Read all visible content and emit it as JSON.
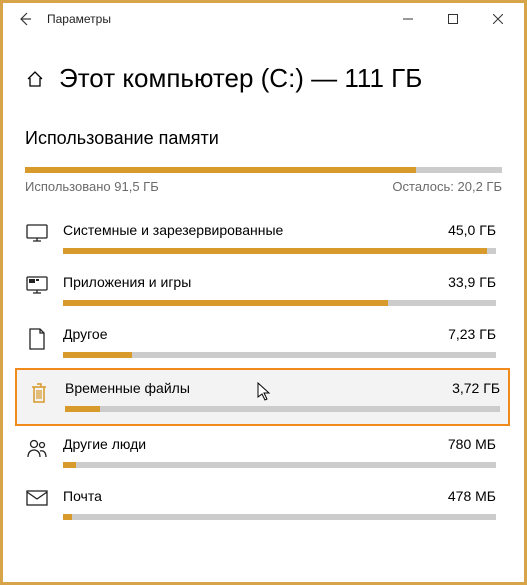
{
  "window": {
    "title": "Параметры"
  },
  "header": {
    "title": "Этот компьютер (C:) — 111 ГБ"
  },
  "usage": {
    "section_title": "Использование памяти",
    "used_label": "Использовано 91,5 ГБ",
    "remaining_label": "Осталось: 20,2 ГБ",
    "fill_percent": 82
  },
  "categories": [
    {
      "icon": "system",
      "label": "Системные и зарезервированные",
      "size": "45,0 ГБ",
      "fill": 98
    },
    {
      "icon": "apps",
      "label": "Приложения и игры",
      "size": "33,9 ГБ",
      "fill": 75
    },
    {
      "icon": "other",
      "label": "Другое",
      "size": "7,23 ГБ",
      "fill": 16
    },
    {
      "icon": "temp",
      "label": "Временные файлы",
      "size": "3,72 ГБ",
      "fill": 8,
      "highlighted": true
    },
    {
      "icon": "people",
      "label": "Другие люди",
      "size": "780 МБ",
      "fill": 3
    },
    {
      "icon": "mail",
      "label": "Почта",
      "size": "478 МБ",
      "fill": 2
    }
  ],
  "chart_data": {
    "type": "bar",
    "title": "Использование памяти — Этот компьютер (C:) 111 ГБ",
    "total_gb": 111,
    "used_gb": 91.5,
    "free_gb": 20.2,
    "series": [
      {
        "name": "Системные и зарезервированные",
        "value": 45.0,
        "unit": "ГБ"
      },
      {
        "name": "Приложения и игры",
        "value": 33.9,
        "unit": "ГБ"
      },
      {
        "name": "Другое",
        "value": 7.23,
        "unit": "ГБ"
      },
      {
        "name": "Временные файлы",
        "value": 3.72,
        "unit": "ГБ"
      },
      {
        "name": "Другие люди",
        "value": 0.78,
        "unit": "ГБ"
      },
      {
        "name": "Почта",
        "value": 0.478,
        "unit": "ГБ"
      }
    ]
  }
}
